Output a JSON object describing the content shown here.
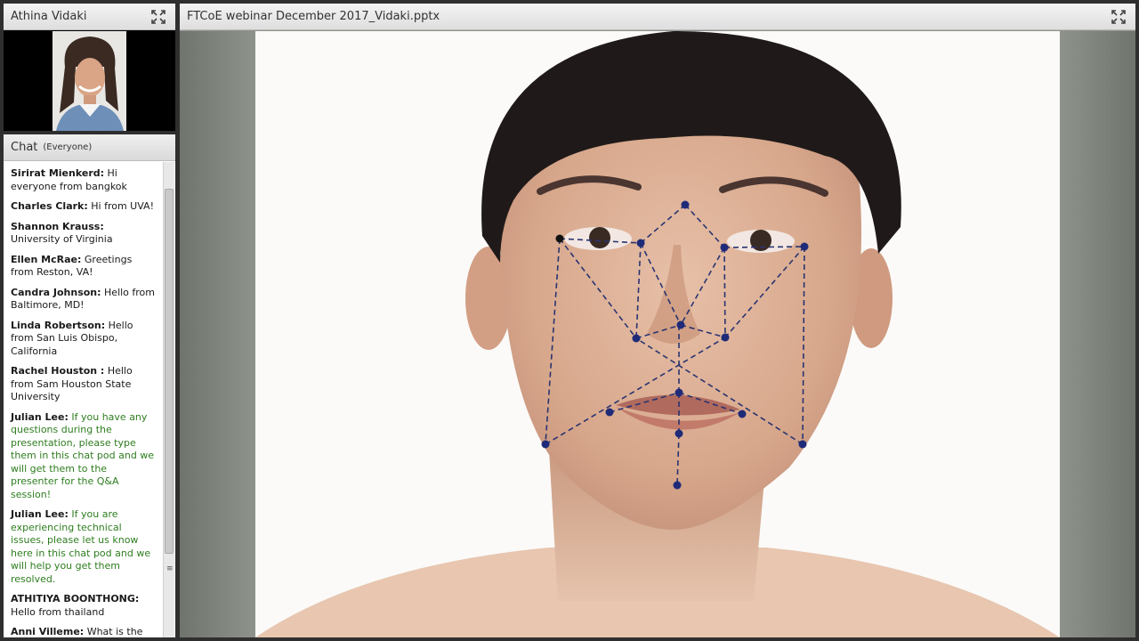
{
  "camera_pod": {
    "title": "Athina Vidaki"
  },
  "share_pod": {
    "title": "FTCoE webinar December 2017_Vidaki.pptx"
  },
  "chat_pod": {
    "title": "Chat",
    "audience": "(Everyone)",
    "messages": [
      {
        "sender": "Sirirat Mienkerd:",
        "text": " Hi everyone from bangkok",
        "host": false
      },
      {
        "sender": "Charles Clark:",
        "text": " Hi from UVA!",
        "host": false
      },
      {
        "sender": "Shannon Krauss:",
        "text": " University of Virginia",
        "host": false
      },
      {
        "sender": "Ellen McRae:",
        "text": " Greetings from Reston, VA!",
        "host": false
      },
      {
        "sender": "Candra Johnson:",
        "text": " Hello from Baltimore, MD!",
        "host": false
      },
      {
        "sender": "Linda Robertson:",
        "text": " Hello from San Luis Obispo, California",
        "host": false
      },
      {
        "sender": "Rachel  Houston :",
        "text": " Hello from Sam Houston State University",
        "host": false
      },
      {
        "sender": "Julian Lee:",
        "text": " If you have any questions during the presentation, please type them in this chat pod and we will get them to the presenter for the Q&A session!",
        "host": true
      },
      {
        "sender": "Julian Lee:",
        "text": " If you are experiencing technical issues, please let us know here in this chat pod and we will help you get them resolved.",
        "host": true
      },
      {
        "sender": "ATHITIYA BOONTHONG:",
        "text": " Hello from thailand",
        "host": false
      },
      {
        "sender": "Anni Villeme:",
        "text": " What is the passcode for the toll free number",
        "host": false
      }
    ]
  },
  "icons": {
    "fullscreen": "expand-arrows-icon",
    "scroll_grip": "grip-lines-icon"
  },
  "colors": {
    "landmark": "#1f2b78",
    "host_text": "#2e7d1f"
  }
}
